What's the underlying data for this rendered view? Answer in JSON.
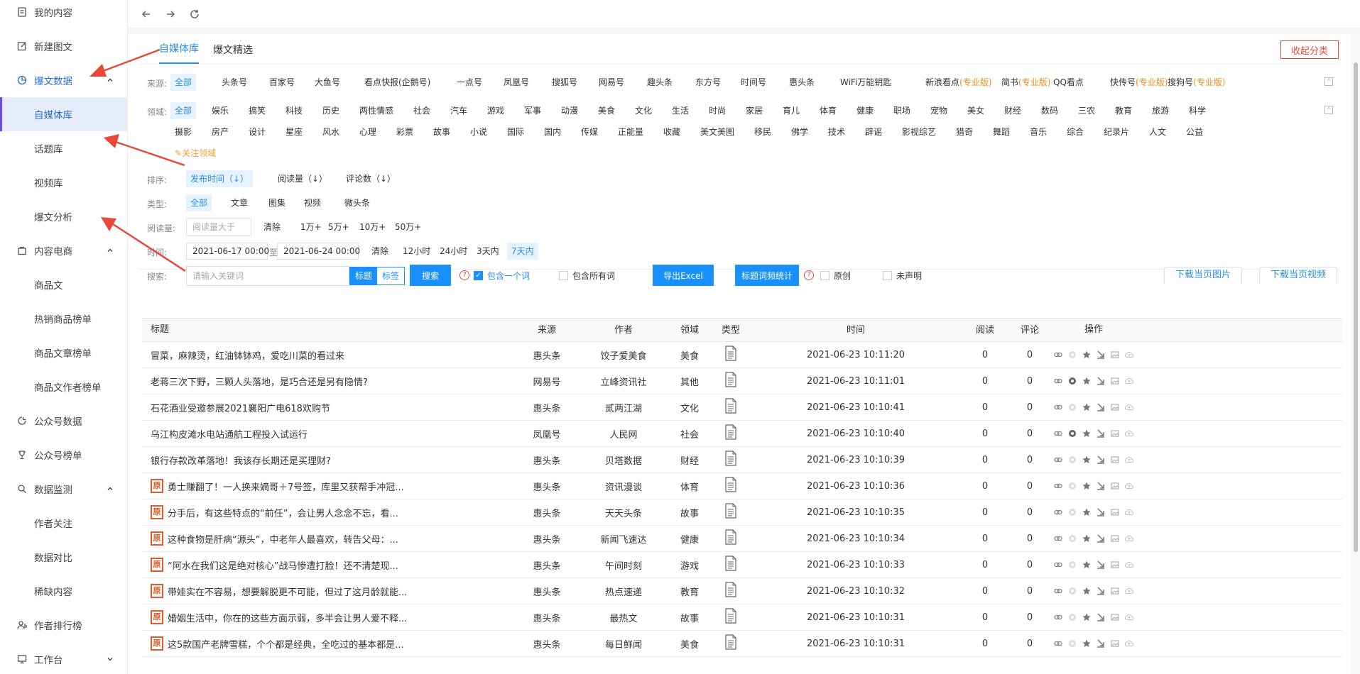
{
  "sidebar": {
    "items": [
      {
        "label": "我的内容",
        "icon": "document-icon",
        "level": 1
      },
      {
        "label": "新建图文",
        "icon": "edit-icon",
        "level": 1
      },
      {
        "label": "爆文数据",
        "icon": "pie-chart-icon",
        "level": 1,
        "expanded": true,
        "highlight": true
      },
      {
        "label": "自媒体库",
        "level": 2,
        "active": true
      },
      {
        "label": "话题库",
        "level": 2
      },
      {
        "label": "视频库",
        "level": 2
      },
      {
        "label": "爆文分析",
        "level": 2
      },
      {
        "label": "内容电商",
        "icon": "shopping-icon",
        "level": 1,
        "expanded": true
      },
      {
        "label": "商品文",
        "level": 2
      },
      {
        "label": "热销商品榜单",
        "level": 2
      },
      {
        "label": "商品文章榜单",
        "level": 2
      },
      {
        "label": "商品文作者榜单",
        "level": 2
      },
      {
        "label": "公众号数据",
        "icon": "chart-icon",
        "level": 1
      },
      {
        "label": "公众号榜单",
        "icon": "trophy-icon",
        "level": 1
      },
      {
        "label": "数据监测",
        "icon": "search-icon",
        "level": 1,
        "expanded": true
      },
      {
        "label": "作者关注",
        "level": 2
      },
      {
        "label": "数据对比",
        "level": 2
      },
      {
        "label": "稀缺内容",
        "level": 2
      },
      {
        "label": "作者排行榜",
        "icon": "user-rank-icon",
        "level": 1
      },
      {
        "label": "工作台",
        "icon": "monitor-icon",
        "level": 1,
        "chevron": "down"
      }
    ]
  },
  "tabs": [
    {
      "label": "自媒体库",
      "active": true
    },
    {
      "label": "爆文精选",
      "active": false
    }
  ],
  "collapse_label": "收起分类",
  "filters": {
    "source_label": "来源:",
    "sources": [
      {
        "t": "全部",
        "sel": true
      },
      {
        "t": "头条号"
      },
      {
        "t": "百家号"
      },
      {
        "t": "大鱼号"
      },
      {
        "t": "看点快报(企鹅号)"
      },
      {
        "t": "一点号"
      },
      {
        "t": "凤凰号"
      },
      {
        "t": "搜狐号"
      },
      {
        "t": "网易号"
      },
      {
        "t": "趣头条"
      },
      {
        "t": "东方号"
      },
      {
        "t": "时间号"
      },
      {
        "t": "惠头条"
      },
      {
        "t": "WiFi万能钥匙"
      },
      {
        "t": "新浪看点",
        "pro": "(专业版)"
      },
      {
        "t": "简书",
        "pro": "(专业版)"
      },
      {
        "t": "QQ看点"
      },
      {
        "t": "快传号",
        "pro": "(专业版)"
      },
      {
        "t": "搜狗号",
        "pro": "(专业版)"
      }
    ],
    "field_label": "领域:",
    "fields_row1": [
      "全部",
      "娱乐",
      "搞笑",
      "科技",
      "历史",
      "两性情感",
      "社会",
      "汽车",
      "游戏",
      "军事",
      "动漫",
      "美食",
      "文化",
      "生活",
      "时尚",
      "家居",
      "育儿",
      "体育",
      "健康",
      "职场",
      "宠物",
      "美女",
      "财经",
      "数码",
      "三农",
      "教育",
      "旅游",
      "科学"
    ],
    "fields_row2": [
      "摄影",
      "房产",
      "设计",
      "星座",
      "风水",
      "心理",
      "彩票",
      "故事",
      "小说",
      "国际",
      "国内",
      "传媒",
      "正能量",
      "收藏",
      "美文美图",
      "移民",
      "佛学",
      "技术",
      "辟谣",
      "影视综艺",
      "猎奇",
      "舞蹈",
      "音乐",
      "综合",
      "纪录片",
      "人文",
      "公益"
    ],
    "follow_label": "关注领域",
    "sort_label": "排序:",
    "sorts": [
      {
        "t": "发布时间（↓）",
        "sel": true
      },
      {
        "t": "阅读量（↓）"
      },
      {
        "t": "评论数（↓）"
      }
    ],
    "type_label": "类型:",
    "types": [
      {
        "t": "全部",
        "sel": true
      },
      {
        "t": "文章"
      },
      {
        "t": "图集"
      },
      {
        "t": "视频"
      },
      {
        "t": "微头条"
      }
    ],
    "read_label": "阅读量:",
    "read_placeholder": "阅读量大于",
    "read_opts": [
      "清除",
      "1万+",
      "5万+",
      "10万+",
      "50万+"
    ],
    "time_label": "时间:",
    "time_start": "2021-06-17 00:00",
    "time_sep": "至",
    "time_end": "2021-06-24 00:00",
    "time_opts": [
      {
        "t": "清除"
      },
      {
        "t": "12小时"
      },
      {
        "t": "24小时"
      },
      {
        "t": "3天内"
      },
      {
        "t": "7天内",
        "sel": true
      }
    ],
    "search_label": "搜索:",
    "search_placeholder": "请输入关键词",
    "seg_title": "标题",
    "seg_tag": "标签",
    "search_btn": "搜索",
    "chk_one": "包含一个词",
    "chk_all": "包含所有词",
    "export_btn": "导出Excel",
    "stat_btn": "标题词频统计",
    "chk_orig": "原创",
    "chk_undeclared": "未声明"
  },
  "download": {
    "images": "下载当页图片",
    "videos": "下载当页视频"
  },
  "table": {
    "headers": [
      "标题",
      "来源",
      "作者",
      "领域",
      "类型",
      "时间",
      "阅读",
      "评论",
      "操作"
    ],
    "rows": [
      {
        "title": "冒菜，麻辣烫，红油钵钵鸡，爱吃川菜的看过来",
        "src": "惠头条",
        "author": "饺子爱美食",
        "field": "美食",
        "time": "2021-06-23 10:11:20",
        "read": "0",
        "cmt": "0",
        "orig": false
      },
      {
        "title": "老蒋三次下野，三颗人头落地，是巧合还是另有隐情?",
        "src": "网易号",
        "author": "立峰资讯社",
        "field": "其他",
        "time": "2021-06-23 10:11:01",
        "read": "0",
        "cmt": "0",
        "orig": false
      },
      {
        "title": "石花酒业受邀参展2021襄阳广电618欢购节",
        "src": "惠头条",
        "author": "贰两江湖",
        "field": "文化",
        "time": "2021-06-23 10:10:41",
        "read": "0",
        "cmt": "0",
        "orig": false
      },
      {
        "title": "乌江构皮滩水电站通航工程投入试运行",
        "src": "凤凰号",
        "author": "人民网",
        "field": "社会",
        "time": "2021-06-23 10:10:40",
        "read": "0",
        "cmt": "0",
        "orig": false
      },
      {
        "title": "银行存款改革落地！我该存长期还是买理财?",
        "src": "惠头条",
        "author": "贝塔数据",
        "field": "财经",
        "time": "2021-06-23 10:10:39",
        "read": "0",
        "cmt": "0",
        "orig": false
      },
      {
        "title": "勇士赚翻了！一人换来嫡哥＋7号签，库里又获帮手冲冠...",
        "src": "惠头条",
        "author": "资讯漫谈",
        "field": "体育",
        "time": "2021-06-23 10:10:36",
        "read": "0",
        "cmt": "0",
        "orig": true
      },
      {
        "title": "分手后，有这些特点的“前任”，会让男人念念不忘，看...",
        "src": "惠头条",
        "author": "天天头条",
        "field": "故事",
        "time": "2021-06-23 10:10:35",
        "read": "0",
        "cmt": "0",
        "orig": true
      },
      {
        "title": "这种食物是肝病“源头”，中老年人最喜欢，转告父母：...",
        "src": "惠头条",
        "author": "新闻飞速达",
        "field": "健康",
        "time": "2021-06-23 10:10:34",
        "read": "0",
        "cmt": "0",
        "orig": true
      },
      {
        "title": "“阿水在我们这是绝对核心”战马惨遭打脸！还不清楚现...",
        "src": "惠头条",
        "author": "午间时刻",
        "field": "游戏",
        "time": "2021-06-23 10:10:33",
        "read": "0",
        "cmt": "0",
        "orig": true
      },
      {
        "title": "带娃实在不容易，想要解脱更不可能，但过了这月龄就能...",
        "src": "惠头条",
        "author": "热点速递",
        "field": "教育",
        "time": "2021-06-23 10:10:32",
        "read": "0",
        "cmt": "0",
        "orig": true
      },
      {
        "title": "婚姻生活中，你在的这些方面示弱，多半会让男人爱不释...",
        "src": "惠头条",
        "author": "最热文",
        "field": "故事",
        "time": "2021-06-23 10:10:31",
        "read": "0",
        "cmt": "0",
        "orig": true
      },
      {
        "title": "这5款国产老牌雪糕，个个都是经典，全吃过的基本都是...",
        "src": "惠头条",
        "author": "每日鲜闻",
        "field": "美食",
        "time": "2021-06-23 10:10:31",
        "read": "0",
        "cmt": "0",
        "orig": true
      }
    ]
  },
  "orig_badge": "原",
  "colors": {
    "accent": "#2a8ee8",
    "primary_btn": "#1890ff",
    "danger": "#e74c3c",
    "pro": "#f08d18",
    "arrow": "#e8483a"
  }
}
